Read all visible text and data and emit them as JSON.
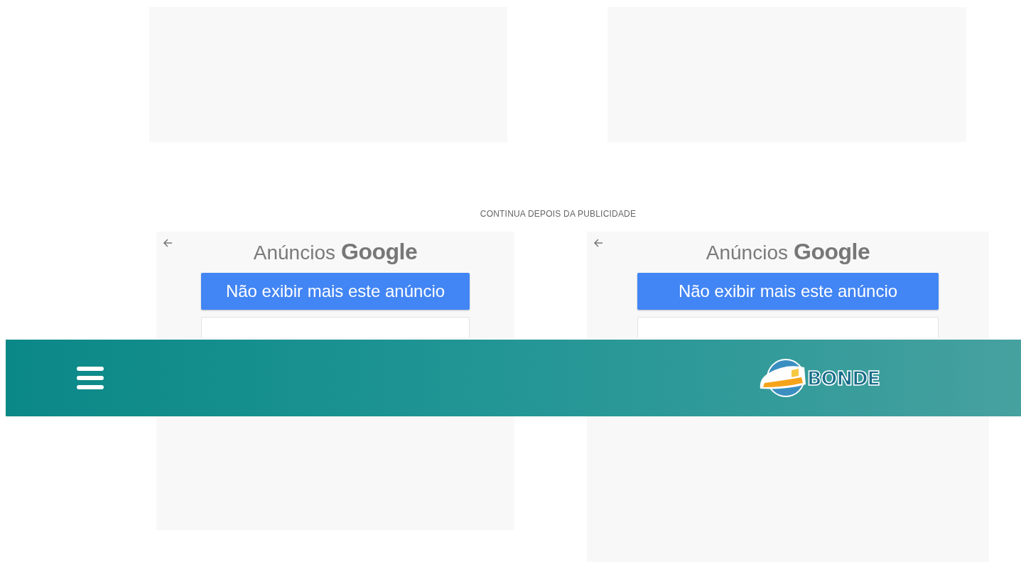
{
  "notice": "CONTINUA DEPOIS DA PUBLICIDADE",
  "ads": [
    {
      "label": "Anúncios",
      "brand": "Google",
      "hide_button": "Não exibir mais este anúncio"
    },
    {
      "label": "Anúncios",
      "brand": "Google",
      "hide_button": "Não exibir mais este anúncio"
    }
  ],
  "header": {
    "logo": "BONDE"
  }
}
